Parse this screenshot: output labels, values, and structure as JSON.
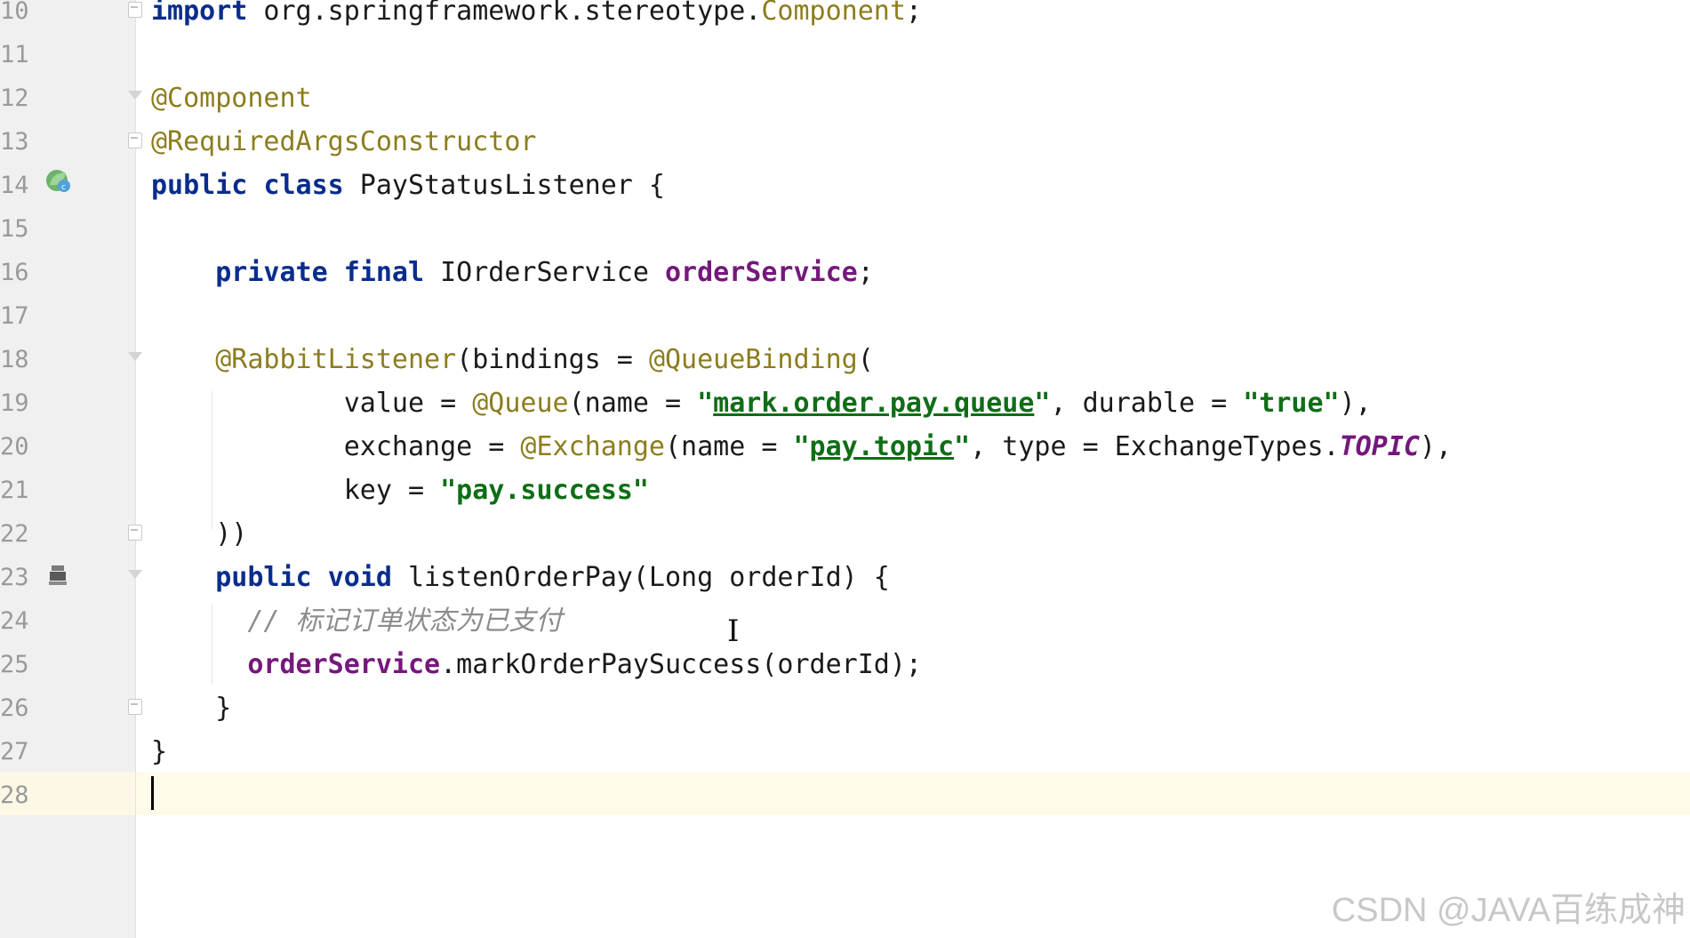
{
  "editor": {
    "lines": [
      {
        "num": "10",
        "tokens": [
          {
            "t": "import",
            "c": "kw"
          },
          {
            "t": " org.springframework.stereotype.",
            "c": ""
          },
          {
            "t": "Component",
            "c": "ann"
          },
          {
            "t": ";",
            "c": ""
          }
        ]
      },
      {
        "num": "11",
        "tokens": []
      },
      {
        "num": "12",
        "tokens": [
          {
            "t": "@Component",
            "c": "ann"
          }
        ]
      },
      {
        "num": "13",
        "tokens": [
          {
            "t": "@RequiredArgsConstructor",
            "c": "ann"
          }
        ]
      },
      {
        "num": "14",
        "tokens": [
          {
            "t": "public",
            "c": "kw"
          },
          {
            "t": " ",
            "c": ""
          },
          {
            "t": "class",
            "c": "kw"
          },
          {
            "t": " PayStatusListener {",
            "c": ""
          }
        ]
      },
      {
        "num": "15",
        "tokens": []
      },
      {
        "num": "16",
        "tokens": [
          {
            "t": "    ",
            "c": ""
          },
          {
            "t": "private",
            "c": "kw"
          },
          {
            "t": " ",
            "c": ""
          },
          {
            "t": "final",
            "c": "kw"
          },
          {
            "t": " IOrderService ",
            "c": ""
          },
          {
            "t": "orderService",
            "c": "field"
          },
          {
            "t": ";",
            "c": ""
          }
        ]
      },
      {
        "num": "17",
        "tokens": []
      },
      {
        "num": "18",
        "tokens": [
          {
            "t": "    ",
            "c": ""
          },
          {
            "t": "@RabbitListener",
            "c": "ann"
          },
          {
            "t": "(bindings = ",
            "c": ""
          },
          {
            "t": "@QueueBinding",
            "c": "ann"
          },
          {
            "t": "(",
            "c": ""
          }
        ]
      },
      {
        "num": "19",
        "tokens": [
          {
            "t": "            value = ",
            "c": ""
          },
          {
            "t": "@Queue",
            "c": "ann"
          },
          {
            "t": "(name = ",
            "c": ""
          },
          {
            "t": "\"",
            "c": "str"
          },
          {
            "t": "mark.order.pay.queue",
            "c": "str u"
          },
          {
            "t": "\"",
            "c": "str"
          },
          {
            "t": ", durable = ",
            "c": ""
          },
          {
            "t": "\"true\"",
            "c": "str"
          },
          {
            "t": "),",
            "c": ""
          }
        ]
      },
      {
        "num": "20",
        "tokens": [
          {
            "t": "            exchange = ",
            "c": ""
          },
          {
            "t": "@Exchange",
            "c": "ann"
          },
          {
            "t": "(name = ",
            "c": ""
          },
          {
            "t": "\"",
            "c": "str"
          },
          {
            "t": "pay.topic",
            "c": "str u"
          },
          {
            "t": "\"",
            "c": "str"
          },
          {
            "t": ", type = ExchangeTypes.",
            "c": ""
          },
          {
            "t": "TOPIC",
            "c": "const"
          },
          {
            "t": "),",
            "c": ""
          }
        ]
      },
      {
        "num": "21",
        "tokens": [
          {
            "t": "            key = ",
            "c": ""
          },
          {
            "t": "\"pay.success\"",
            "c": "str"
          }
        ]
      },
      {
        "num": "22",
        "tokens": [
          {
            "t": "    ))",
            "c": ""
          }
        ]
      },
      {
        "num": "23",
        "tokens": [
          {
            "t": "    ",
            "c": ""
          },
          {
            "t": "public",
            "c": "kw"
          },
          {
            "t": " ",
            "c": ""
          },
          {
            "t": "void",
            "c": "kw"
          },
          {
            "t": " listenOrderPay(Long orderId) {",
            "c": ""
          }
        ]
      },
      {
        "num": "24",
        "tokens": [
          {
            "t": "      ",
            "c": ""
          },
          {
            "t": "// 标记订单状态为已支付",
            "c": "comment"
          }
        ]
      },
      {
        "num": "25",
        "tokens": [
          {
            "t": "      ",
            "c": ""
          },
          {
            "t": "orderService",
            "c": "field"
          },
          {
            "t": ".markOrderPaySuccess(orderId);",
            "c": ""
          }
        ]
      },
      {
        "num": "26",
        "tokens": [
          {
            "t": "    }",
            "c": ""
          }
        ]
      },
      {
        "num": "27",
        "tokens": [
          {
            "t": "}",
            "c": ""
          }
        ]
      },
      {
        "num": "28",
        "tokens": []
      }
    ]
  },
  "gutter_icons": {
    "class_icon": "spring-bean-icon",
    "method_icon": "rabbit-listener-icon"
  },
  "watermark": "CSDN @JAVA百练成神",
  "colors": {
    "keyword": "#0a2d8c",
    "annotation": "#8c7d1e",
    "string": "#0f6e16",
    "field": "#75187c",
    "comment": "#8c8c8c",
    "current_line": "#fefbe9"
  }
}
